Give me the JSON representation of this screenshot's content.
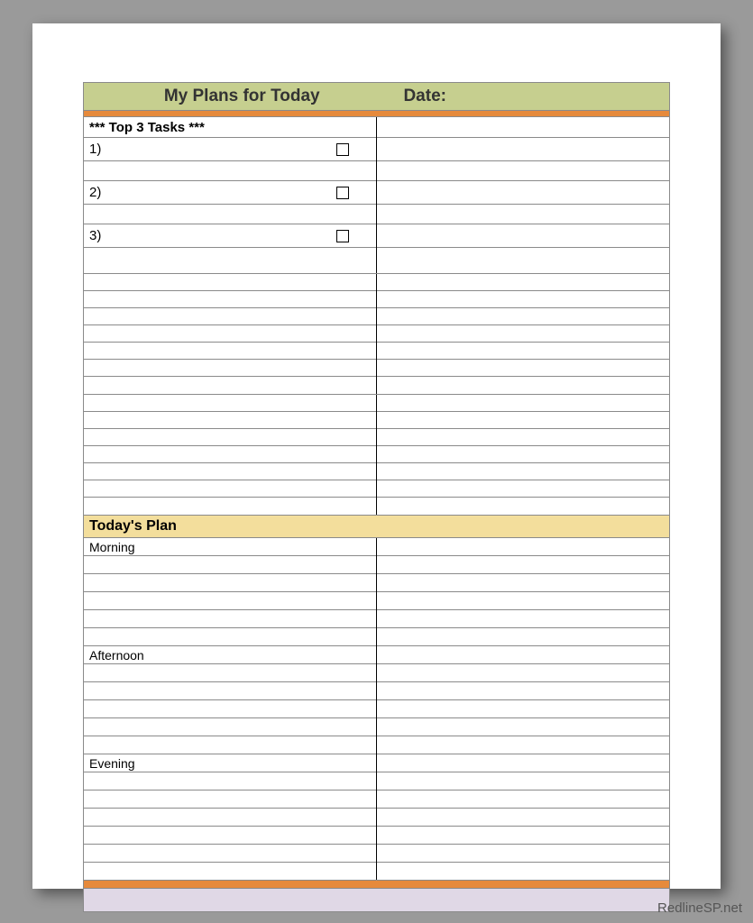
{
  "header": {
    "title": "My Plans for Today",
    "date_label": "Date:"
  },
  "top_tasks": {
    "heading": "*** Top 3 Tasks ***",
    "items": [
      "1)",
      "2)",
      "3)"
    ]
  },
  "plan_section": {
    "heading": "Today's Plan",
    "periods": [
      "Morning",
      "Afternoon",
      "Evening"
    ]
  },
  "watermark": "RedlineSP.net"
}
